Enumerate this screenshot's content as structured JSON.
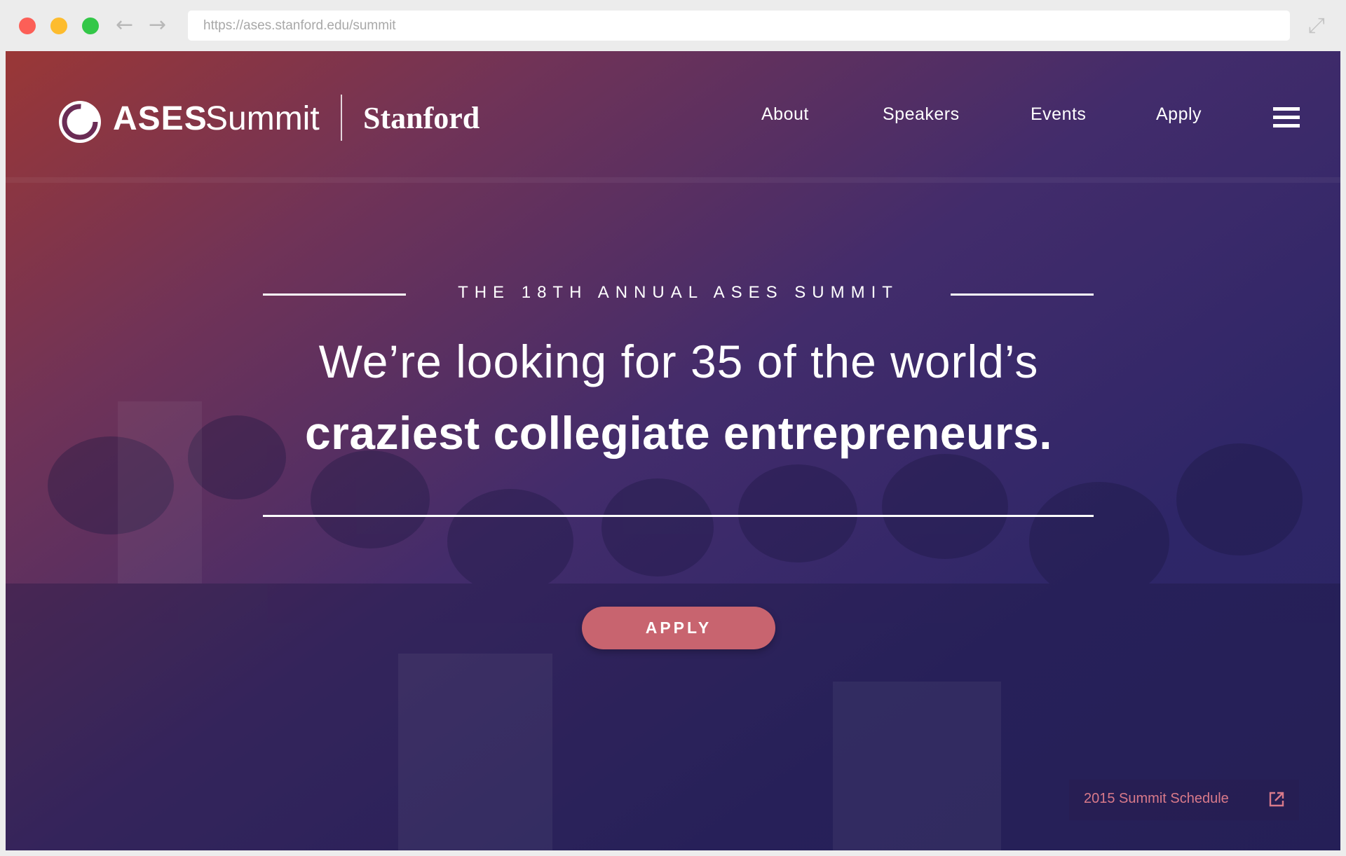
{
  "browser": {
    "url": "https://ases.stanford.edu/summit",
    "back_icon": "arrow-left-icon",
    "forward_icon": "arrow-right-icon",
    "expand_icon": "expand-diagonal-icon"
  },
  "header": {
    "logo_ases": "ASES",
    "logo_summit": "Summit",
    "logo_stanford": "Stanford",
    "nav": [
      {
        "label": "About"
      },
      {
        "label": "Speakers"
      },
      {
        "label": "Events"
      },
      {
        "label": "Apply"
      }
    ],
    "menu_icon": "hamburger-menu-icon"
  },
  "hero": {
    "eyebrow": "THE 18TH ANNUAL ASES SUMMIT",
    "headline_line1": "We’re looking for 35 of the world’s",
    "headline_line2": "craziest collegiate entrepreneurs.",
    "cta_label": "APPLY"
  },
  "footer_link": {
    "label": "2015 Summit Schedule",
    "icon": "external-link-icon"
  },
  "colors": {
    "gradient_start": "#a03834",
    "gradient_end": "#2c2464",
    "cta": "#c8646f",
    "schedule_text": "#d97a8a"
  }
}
